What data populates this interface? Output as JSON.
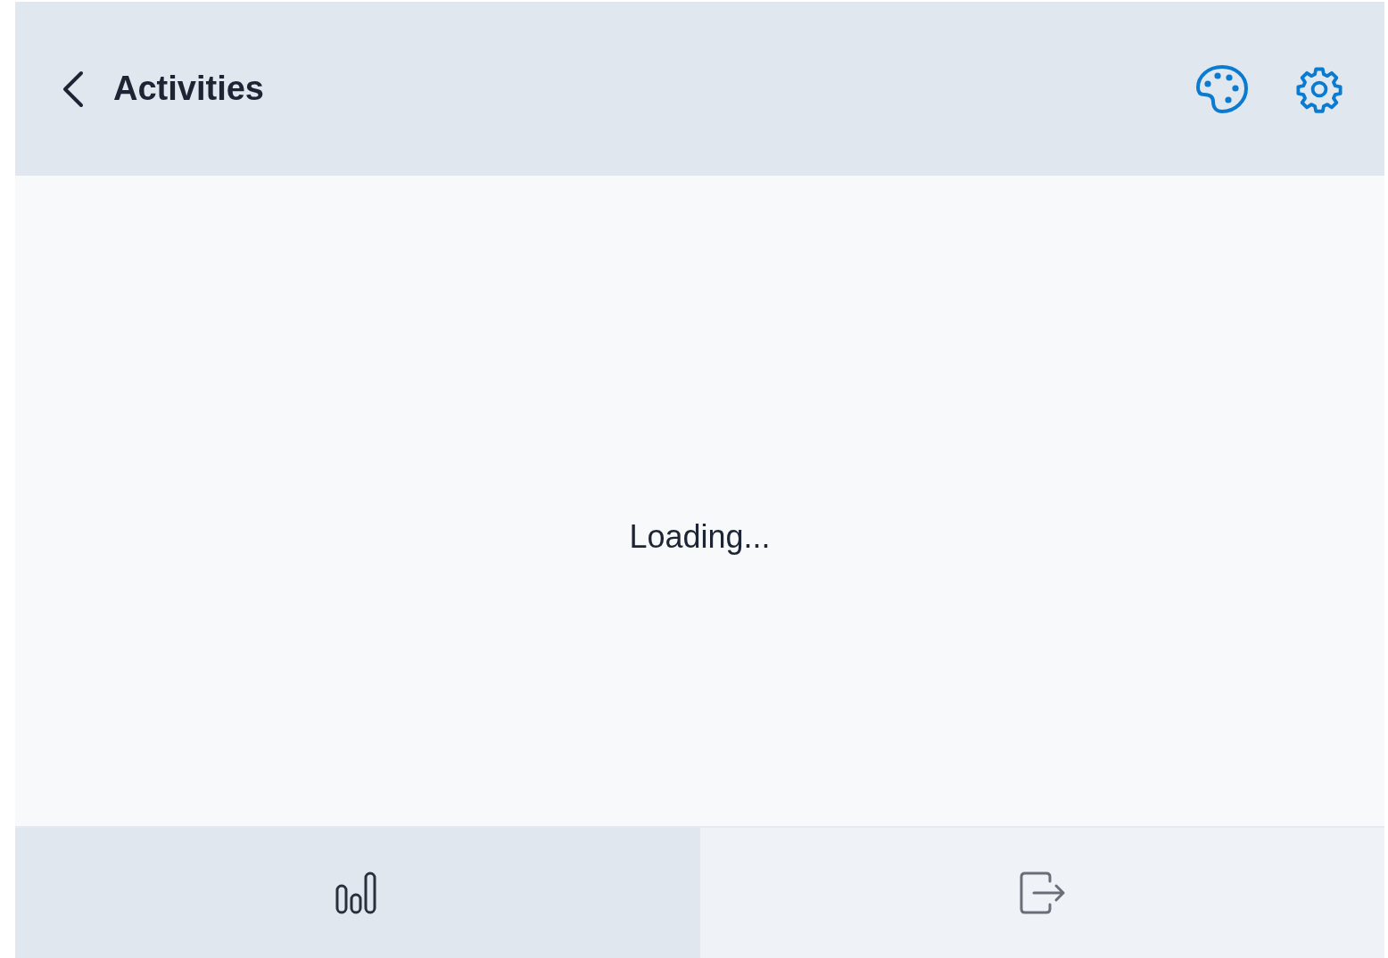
{
  "header": {
    "title": "Activities"
  },
  "content": {
    "message": "Loading..."
  },
  "bottom_tabs": [
    {
      "kind": "stats",
      "selected": true
    },
    {
      "kind": "exit",
      "selected": false
    }
  ]
}
